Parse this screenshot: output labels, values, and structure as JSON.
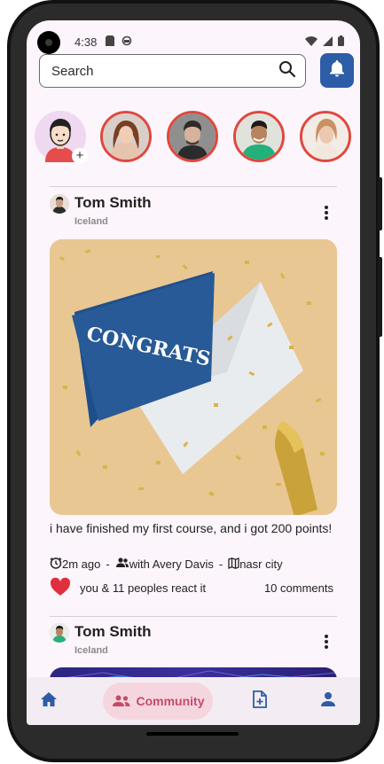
{
  "status_bar": {
    "time": "4:38"
  },
  "search": {
    "placeholder": "Search"
  },
  "posts": [
    {
      "author": "Tom Smith",
      "location": "Iceland",
      "caption": "i have finished my first course, and i got 200 points!",
      "time": "2m ago",
      "with": "with Avery Davis",
      "place": "nasr city",
      "reactions": "you & 11 peoples react it",
      "comments": "10 comments",
      "image_text": "CONGRATS"
    },
    {
      "author": "Tom Smith",
      "location": "Iceland"
    }
  ],
  "bottom_nav": {
    "items": [
      {
        "name": "home",
        "label": ""
      },
      {
        "name": "community",
        "label": "Community"
      },
      {
        "name": "add-post",
        "label": ""
      },
      {
        "name": "profile",
        "label": ""
      }
    ]
  },
  "colors": {
    "accent": "#2d5da6",
    "story_ring": "#e0483d",
    "heart": "#e0303d",
    "nav_active_bg": "#f6d6de",
    "nav_active_fg": "#c44b6a"
  }
}
